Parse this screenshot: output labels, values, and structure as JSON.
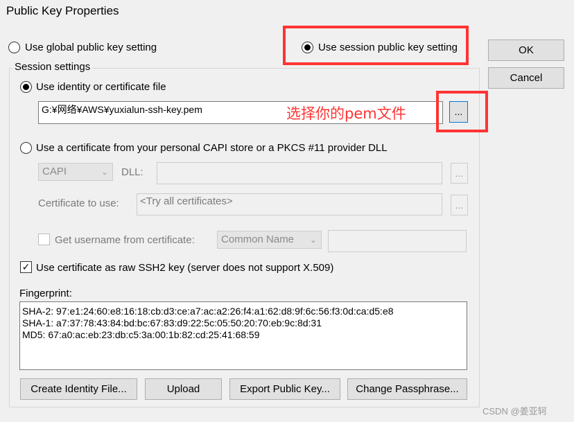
{
  "window": {
    "title": "Public Key Properties"
  },
  "mode": {
    "global_label": "Use global public key setting",
    "session_label": "Use session public key setting"
  },
  "buttons": {
    "ok": "OK",
    "cancel": "Cancel"
  },
  "session": {
    "legend": "Session settings",
    "identity_label": "Use identity or certificate file",
    "identity_path": "G:¥网络¥AWS¥yuxialun-ssh-key.pem",
    "browse": "...",
    "annotation": "选择你的pem文件",
    "capi_label": "Use a certificate from your personal CAPI store or a PKCS #11 provider DLL",
    "capi_select": "CAPI",
    "dll_label": "DLL:",
    "cert_label": "Certificate to use:",
    "cert_value": "<Try all certificates>",
    "username_label": "Get username from certificate:",
    "username_select": "Common Name",
    "raw_label": "Use certificate as raw SSH2 key (server does not support X.509)",
    "raw_checked": "✓",
    "fingerprint_label": "Fingerprint:",
    "fingerprints": [
      "SHA-2: 97:e1:24:60:e8:16:18:cb:d3:ce:a7:ac:a2:26:f4:a1:62:d8:9f:6c:56:f3:0d:ca:d5:e8",
      "SHA-1: a7:37:78:43:84:bd:bc:67:83:d9:22:5c:05:50:20:70:eb:9c:8d:31",
      "MD5: 67:a0:ac:eb:23:db:c5:3a:00:1b:82:cd:25:41:68:59"
    ]
  },
  "actions": {
    "create": "Create Identity File...",
    "upload": "Upload",
    "export": "Export Public Key...",
    "passphrase": "Change Passphrase..."
  },
  "watermark": "CSDN @姜亚轲",
  "colors": {
    "annotation": "#ff3333",
    "focus": "#0078d7"
  }
}
